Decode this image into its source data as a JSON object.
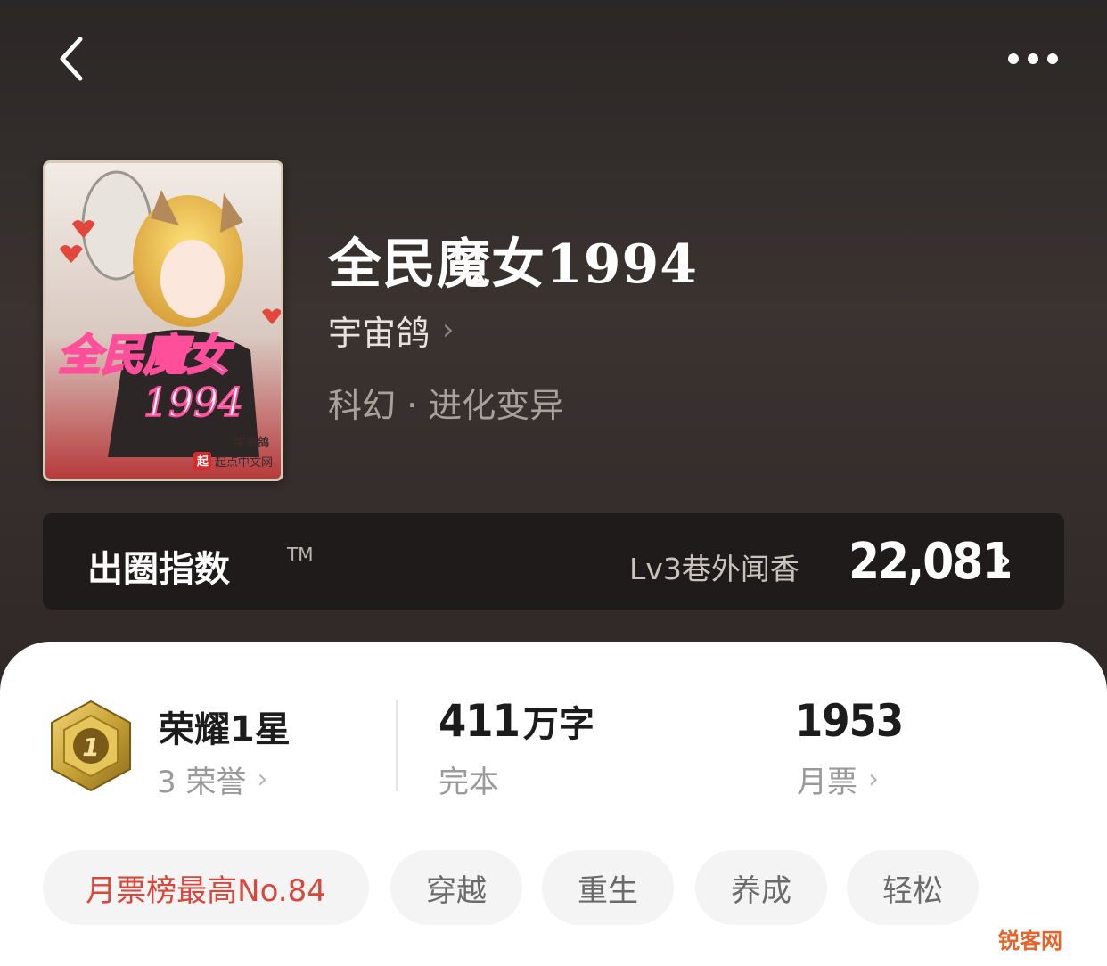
{
  "nav": {
    "back_icon": "chevron-left-icon",
    "more_icon": "more-dots-icon"
  },
  "book": {
    "title": "全民魔女1994",
    "author": "宇宙鸽",
    "author_chevron": "›",
    "genre": "科幻 · 进化变异",
    "cover": {
      "title_text": "全民魔女",
      "year_text": "1994",
      "author_text": "宇宙鸽",
      "publisher_text": "起点中文网",
      "publisher_logo": "起"
    }
  },
  "index": {
    "label": "出圈指数",
    "tm": "TM",
    "level": "Lv3巷外闻香",
    "value": "22,081",
    "chevron": "›"
  },
  "stats": {
    "honor": {
      "title": "荣耀1星",
      "badge_number": "1",
      "sub": "3 荣誉",
      "chevron": "›"
    },
    "words": {
      "number": "411",
      "unit": "万字",
      "sub": "完本"
    },
    "tickets": {
      "number": "1953",
      "sub": "月票",
      "chevron": "›"
    }
  },
  "tags": [
    "月票榜最高No.84",
    "穿越",
    "重生",
    "养成",
    "轻松"
  ],
  "watermark": "锐客网",
  "colors": {
    "hero_bg": "#2b2726",
    "rank_tag": "#d9463b",
    "badge_gold": "#c9a436"
  }
}
